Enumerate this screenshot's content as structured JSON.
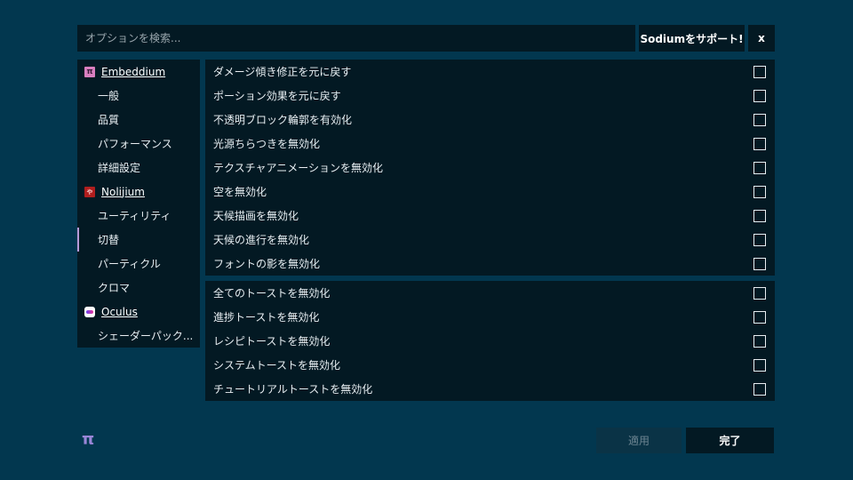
{
  "search": {
    "placeholder": "オプションを検索...",
    "value": ""
  },
  "header": {
    "support_label": "Sodiumをサポート!",
    "close_label": "x"
  },
  "sidebar": {
    "items": [
      {
        "type": "mod",
        "label": "Embeddium",
        "icon": "embeddium-icon",
        "icon_glyph": "π"
      },
      {
        "type": "page",
        "label": "一般"
      },
      {
        "type": "page",
        "label": "品質"
      },
      {
        "type": "page",
        "label": "パフォーマンス"
      },
      {
        "type": "page",
        "label": "詳細設定"
      },
      {
        "type": "mod",
        "label": "Nolijium",
        "icon": "nolijium-icon",
        "icon_glyph": "ゃ"
      },
      {
        "type": "page",
        "label": "ユーティリティ"
      },
      {
        "type": "page",
        "label": "切替",
        "selected": true
      },
      {
        "type": "page",
        "label": "パーティクル"
      },
      {
        "type": "page",
        "label": "クロマ"
      },
      {
        "type": "mod",
        "label": "Oculus",
        "icon": "oculus-icon",
        "icon_glyph": ""
      },
      {
        "type": "page",
        "label": "シェーダーパック..."
      }
    ]
  },
  "groups": [
    {
      "options": [
        {
          "label": "ダメージ傾き修正を元に戻す",
          "checked": false
        },
        {
          "label": "ポーション効果を元に戻す",
          "checked": false
        },
        {
          "label": "不透明ブロック輪郭を有効化",
          "checked": false
        },
        {
          "label": "光源ちらつきを無効化",
          "checked": false
        },
        {
          "label": "テクスチャアニメーションを無効化",
          "checked": false
        },
        {
          "label": "空を無効化",
          "checked": false
        },
        {
          "label": "天候描画を無効化",
          "checked": false
        },
        {
          "label": "天候の進行を無効化",
          "checked": false
        },
        {
          "label": "フォントの影を無効化",
          "checked": false
        }
      ]
    },
    {
      "options": [
        {
          "label": "全てのトーストを無効化",
          "checked": false
        },
        {
          "label": "進捗トーストを無効化",
          "checked": false
        },
        {
          "label": "レシピトーストを無効化",
          "checked": false
        },
        {
          "label": "システムトーストを無効化",
          "checked": false
        },
        {
          "label": "チュートリアルトーストを無効化",
          "checked": false
        }
      ]
    }
  ],
  "footer": {
    "logo_glyph": "π",
    "apply_label": "適用",
    "done_label": "完了"
  },
  "colors": {
    "background": "#02374f",
    "panel": "#031923",
    "accent": "#b79ad8"
  }
}
